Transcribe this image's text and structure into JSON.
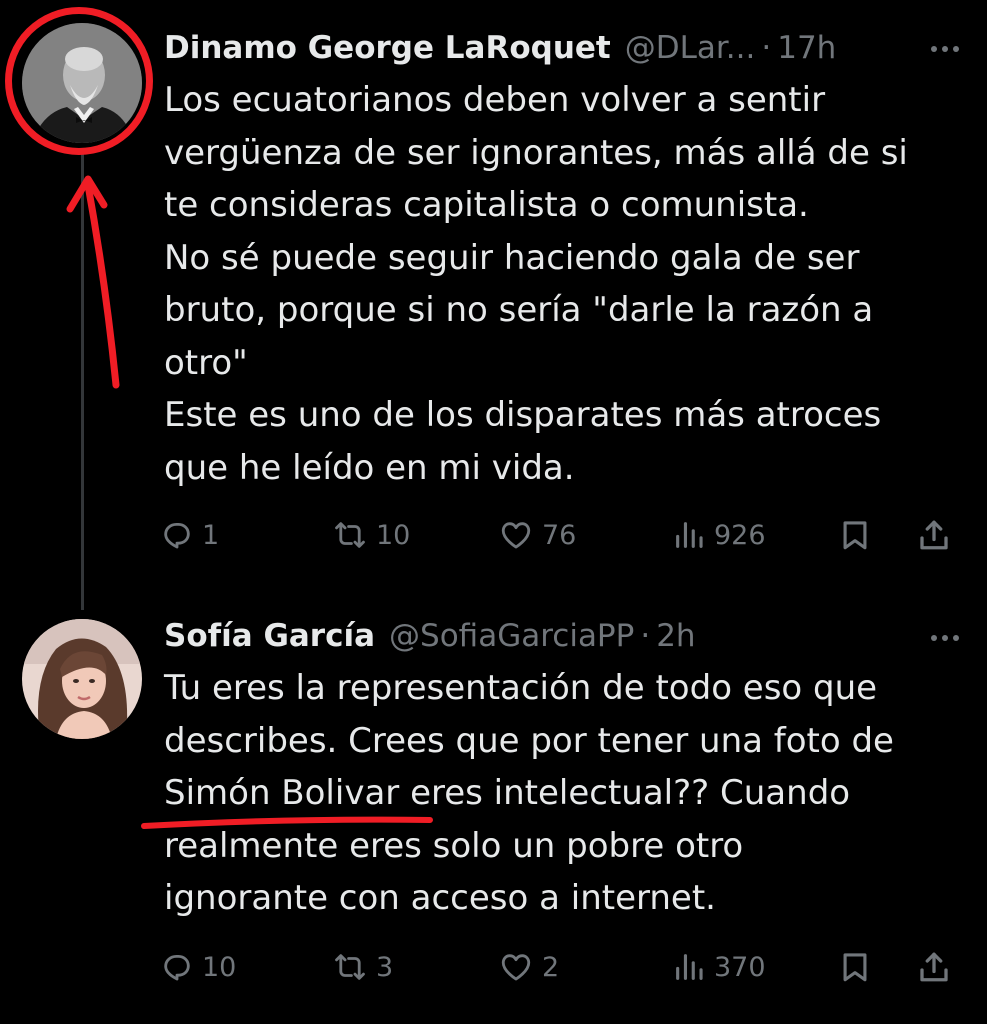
{
  "tweets": [
    {
      "display_name": "Dinamo George LaRoquet",
      "handle": "@DLar...",
      "separator": "·",
      "time": "17h",
      "text_lines": [
        "Los ecuatorianos deben volver a sentir",
        "vergüenza de ser ignorantes, más allá de si",
        "te consideras capitalista o comunista.",
        "No sé puede seguir haciendo gala de ser",
        "bruto, porque si no sería \"darle la razón a",
        "otro\"",
        "Este es uno de los disparates más atroces",
        "que he leído en mi vida."
      ],
      "stats": {
        "replies": "1",
        "retweets": "10",
        "likes": "76",
        "views": "926"
      }
    },
    {
      "display_name": "Sofía García",
      "handle": "@SofiaGarciaPP",
      "separator": "·",
      "time": "2h",
      "text_lines": [
        "Tu eres la representación de todo eso que",
        "describes. Crees que por tener una foto de",
        "Simón Bolivar eres intelectual?? Cuando",
        "realmente eres solo un pobre otro",
        "ignorante con acceso a internet."
      ],
      "stats": {
        "replies": "10",
        "retweets": "3",
        "likes": "2",
        "views": "370"
      }
    }
  ],
  "icons": {
    "reply": "reply-icon",
    "retweet": "retweet-icon",
    "like": "heart-icon",
    "views": "views-icon",
    "bookmark": "bookmark-icon",
    "share": "share-icon",
    "more": "more-icon"
  },
  "colors": {
    "background": "#000000",
    "primary_text": "#e7e9ea",
    "secondary_text": "#71767b",
    "annotation_red": "#f01d25"
  }
}
